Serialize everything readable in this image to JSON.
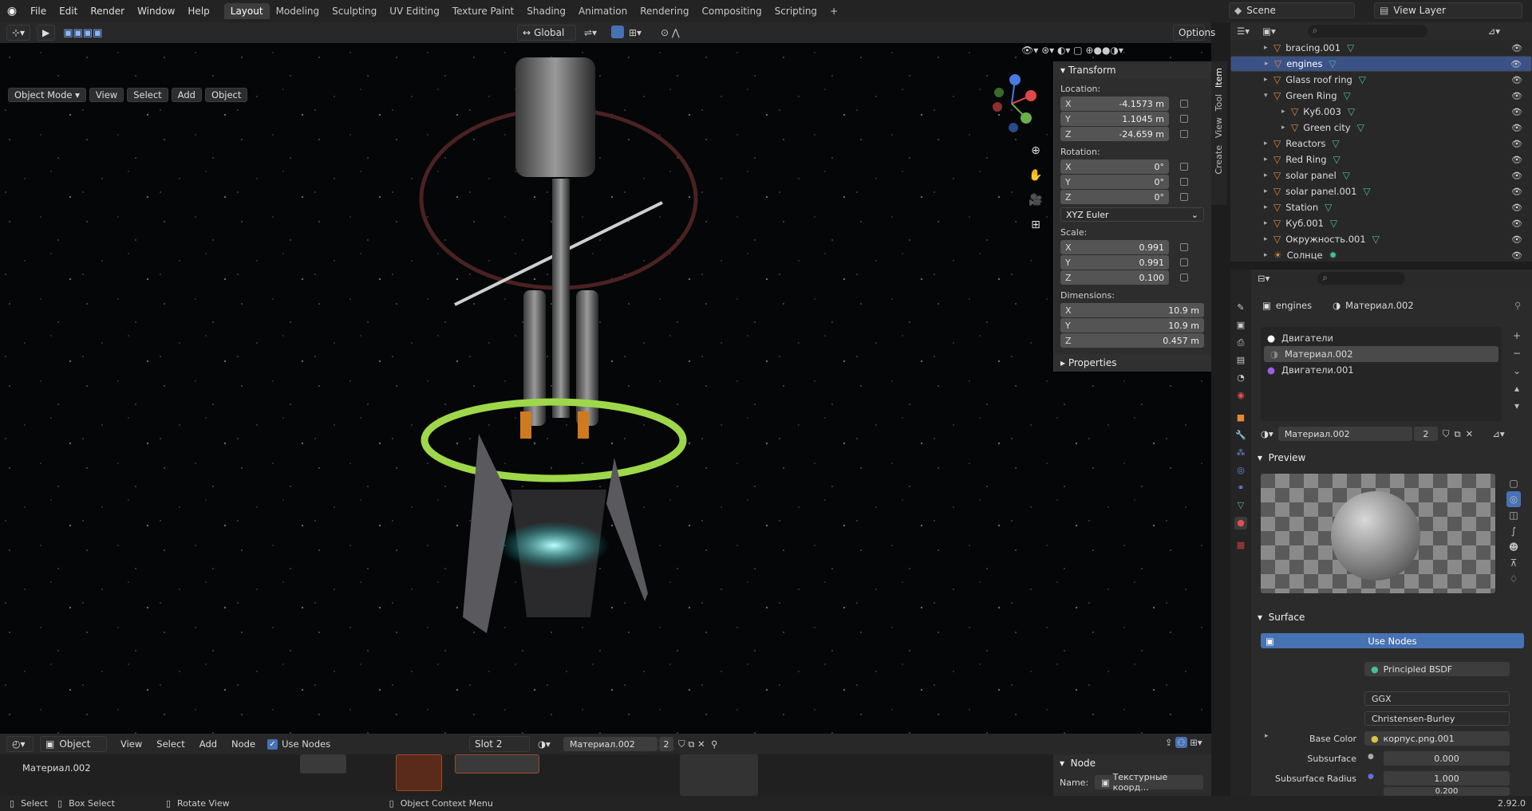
{
  "menu": [
    "File",
    "Edit",
    "Render",
    "Window",
    "Help"
  ],
  "workspaces": [
    "Layout",
    "Modeling",
    "Sculpting",
    "UV Editing",
    "Texture Paint",
    "Shading",
    "Animation",
    "Rendering",
    "Compositing",
    "Scripting"
  ],
  "scene": "Scene",
  "view_layer": "View Layer",
  "header": {
    "orientation": "Global",
    "options": "Options"
  },
  "viewport": {
    "mode": "Object Mode",
    "menus": [
      "View",
      "Select",
      "Add",
      "Object"
    ]
  },
  "npanel": {
    "title": "Transform",
    "location_label": "Location:",
    "loc": {
      "x": "-4.1573 m",
      "y": "1.1045 m",
      "z": "-24.659 m"
    },
    "rotation_label": "Rotation:",
    "rot": {
      "x": "0°",
      "y": "0°",
      "z": "0°"
    },
    "rot_mode": "XYZ Euler",
    "scale_label": "Scale:",
    "scale": {
      "x": "0.991",
      "y": "0.991",
      "z": "0.100"
    },
    "dim_label": "Dimensions:",
    "dim": {
      "x": "10.9 m",
      "y": "10.9 m",
      "z": "0.457 m"
    },
    "properties": "Properties",
    "tabs": [
      "Item",
      "Tool",
      "View",
      "Create"
    ]
  },
  "outliner": [
    {
      "name": "bracing.001",
      "indent": 0
    },
    {
      "name": "engines",
      "indent": 0,
      "selected": true
    },
    {
      "name": "Glass roof ring",
      "indent": 0
    },
    {
      "name": "Green Ring",
      "indent": 0,
      "open": true
    },
    {
      "name": "Куб.003",
      "indent": 1
    },
    {
      "name": "Green city",
      "indent": 1
    },
    {
      "name": "Reactors",
      "indent": 0
    },
    {
      "name": "Red Ring",
      "indent": 0
    },
    {
      "name": "solar panel",
      "indent": 0
    },
    {
      "name": "solar panel.001",
      "indent": 0
    },
    {
      "name": "Station",
      "indent": 0
    },
    {
      "name": "Куб.001",
      "indent": 0
    },
    {
      "name": "Окружность.001",
      "indent": 0
    },
    {
      "name": "Солнце",
      "indent": 0
    }
  ],
  "props": {
    "object": "engines",
    "material": "Материал.002",
    "slots": [
      "Двигатели",
      "Материал.002",
      "Двигатели.001"
    ],
    "material_field": "Материал.002",
    "users": "2",
    "preview": "Preview",
    "surface_section": "Surface",
    "use_nodes": "Use Nodes",
    "surface_label": "Surface",
    "surface_value": "Principled BSDF",
    "distribution": "GGX",
    "subsurface_method": "Christensen-Burley",
    "base_color_label": "Base Color",
    "base_color_value": "корпус.png.001",
    "subsurface_label": "Subsurface",
    "subsurface_value": "0.000",
    "ss_radius_label": "Subsurface Radius",
    "ss_radius_value": "1.000",
    "ss_radius_value2": "0.200"
  },
  "nodebar": {
    "object": "Object",
    "menus": [
      "View",
      "Select",
      "Add",
      "Node"
    ],
    "use_nodes": "Use Nodes",
    "slot": "Slot 2",
    "material": "Материал.002",
    "users": "2",
    "node_title": "Материал.002"
  },
  "node_panel": {
    "title": "Node",
    "name_label": "Name:",
    "name_value": "Текстурные коорд..."
  },
  "status": {
    "select": "Select",
    "box_select": "Box Select",
    "rotate": "Rotate View",
    "context": "Object Context Menu",
    "version": "2.92.0"
  }
}
